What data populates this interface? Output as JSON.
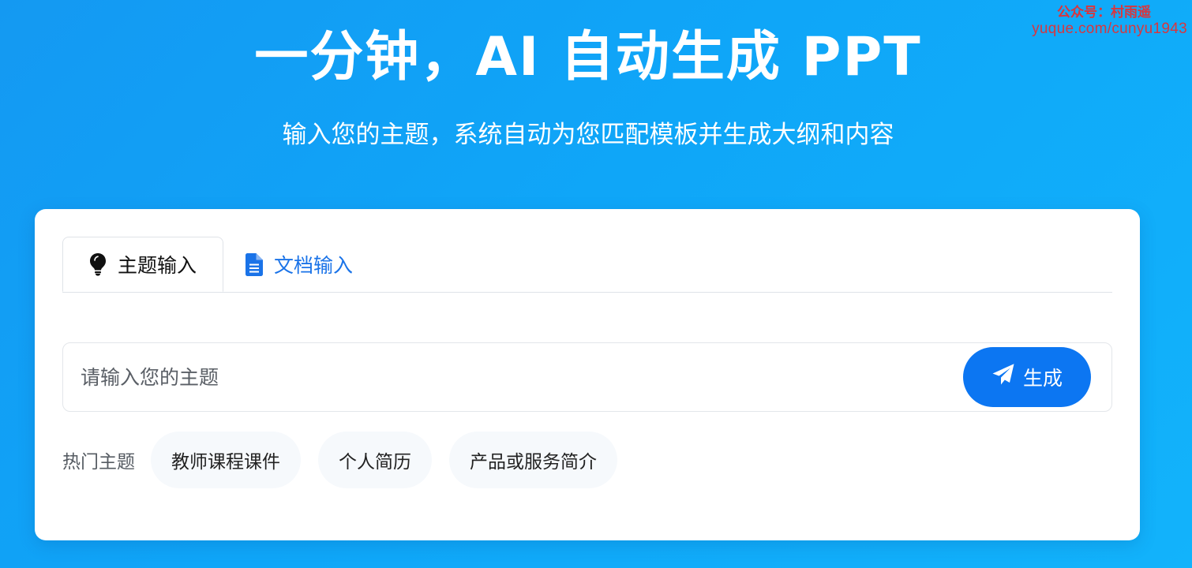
{
  "watermark": {
    "line1": "公众号：村雨遥",
    "line2": "yuque.com/cunyu1943"
  },
  "hero": {
    "title": "一分钟，AI 自动生成 PPT",
    "subtitle": "输入您的主题，系统自动为您匹配模板并生成大纲和内容"
  },
  "tabs": [
    {
      "label": "主题输入",
      "icon": "lightbulb-icon",
      "active": true
    },
    {
      "label": "文档输入",
      "icon": "document-icon",
      "active": false
    }
  ],
  "search": {
    "value": "",
    "placeholder": "请输入您的主题",
    "button_label": "生成",
    "button_icon": "paper-plane-icon"
  },
  "hot_topics": {
    "label": "热门主题",
    "items": [
      "教师课程课件",
      "个人简历",
      "产品或服务简介"
    ]
  },
  "colors": {
    "background_start": "#1499f2",
    "background_end": "#12b3fb",
    "accent": "#0c76f2",
    "link_tab": "#1a73e8",
    "watermark": "#d9363e"
  }
}
